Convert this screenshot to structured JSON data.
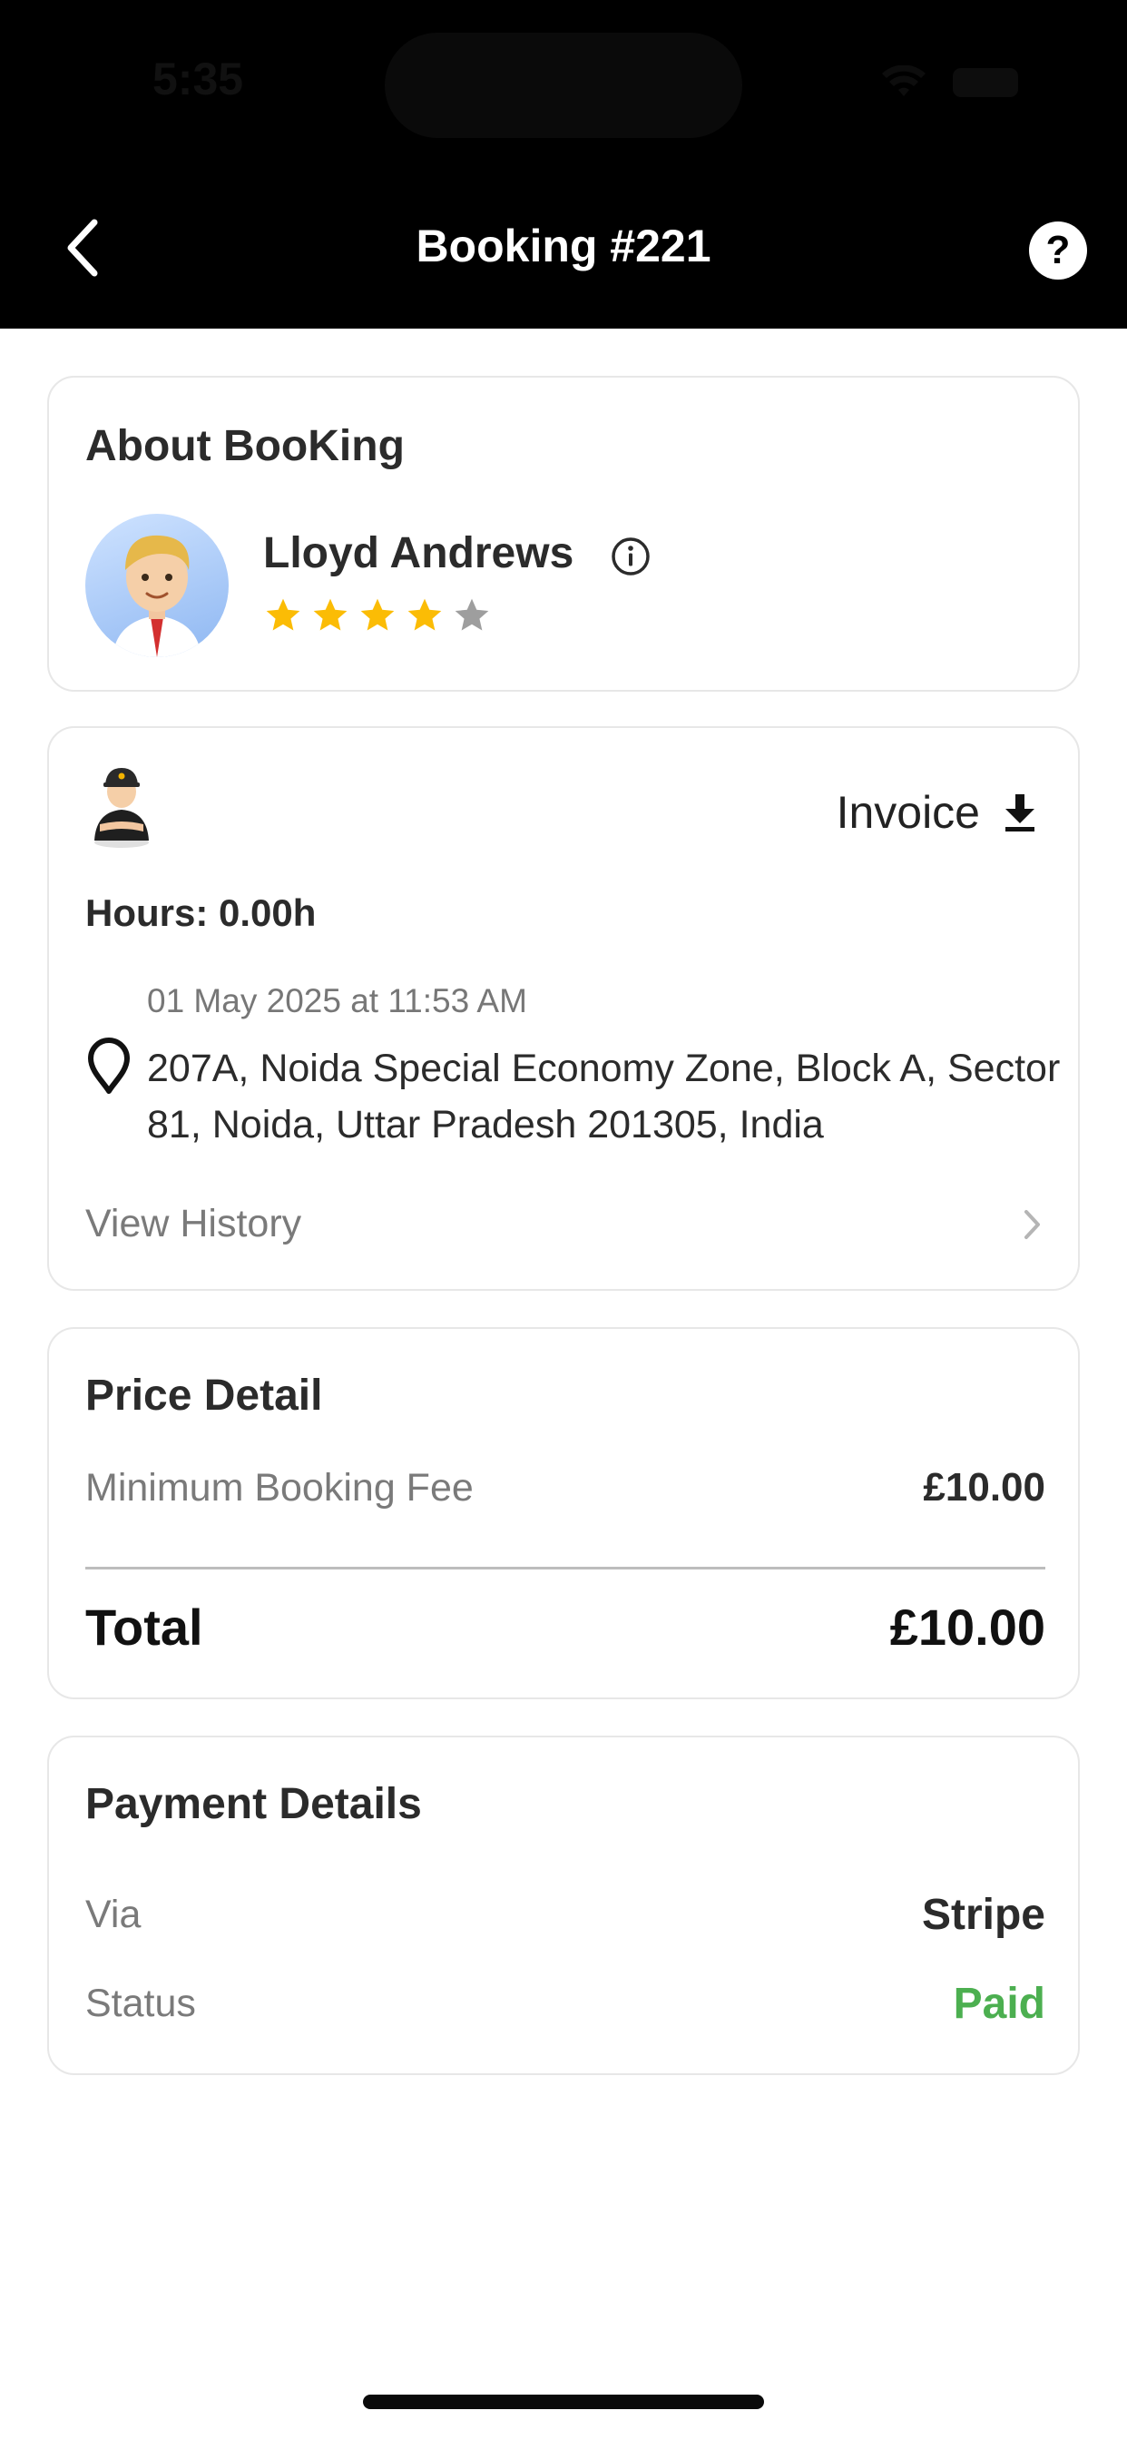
{
  "status_bar": {
    "time": "5:35"
  },
  "header": {
    "title": "Booking #221",
    "back_icon": "chevron-left-icon",
    "help_icon": "help-circle-icon",
    "help_glyph": "?"
  },
  "about_booking": {
    "title": "About BooKing",
    "customer_name": "Lloyd Andrews",
    "rating": {
      "filled": 4,
      "total": 5
    }
  },
  "booking_detail": {
    "invoice_label": "Invoice",
    "hours": "Hours: 0.00h",
    "datetime": "01 May 2025 at 11:53 AM",
    "address": "207A, Noida Special Economy Zone, Block A, Sector 81, Noida, Uttar Pradesh 201305, India",
    "view_history_label": "View History"
  },
  "price_detail": {
    "title": "Price Detail",
    "fee_label": "Minimum Booking Fee",
    "fee_value": "£10.00",
    "total_label": "Total",
    "total_value": "£10.00"
  },
  "payment_details": {
    "title": "Payment Details",
    "via_label": "Via",
    "via_value": "Stripe",
    "status_label": "Status",
    "status_value": "Paid"
  },
  "colors": {
    "header_bg": "#000000",
    "star_filled": "#fbbc05",
    "star_empty": "#9e9e9e",
    "paid_green": "#4caf50"
  }
}
